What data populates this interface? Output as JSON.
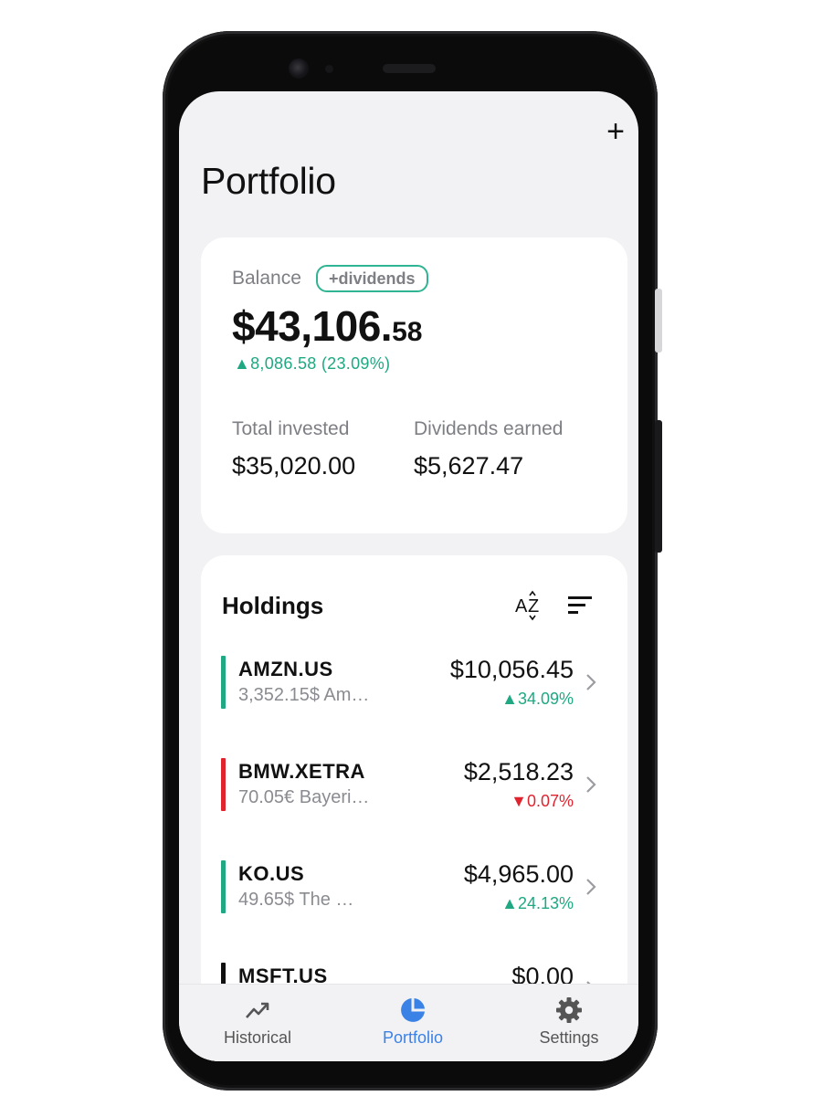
{
  "header": {
    "title": "Portfolio",
    "add_icon": "plus-icon",
    "add_label": "+"
  },
  "balance": {
    "label": "Balance",
    "badge": "+dividends",
    "amount_main": "$43,106.",
    "amount_cents": "58",
    "change": "▲8,086.58 (23.09%)",
    "total_invested_label": "Total invested",
    "total_invested_value": "$35,020.00",
    "dividends_label": "Dividends earned",
    "dividends_value": "$5,627.47"
  },
  "holdings": {
    "title": "Holdings",
    "sort_alpha_icon": "sort-alphabetical-icon",
    "sort_icon": "sort-lines-icon",
    "items": [
      {
        "ticker": "AMZN.US",
        "sub": "3,352.15$  Am…",
        "value": "$10,056.45",
        "change": "▲34.09%",
        "trend": "up"
      },
      {
        "ticker": "BMW.XETRA",
        "sub": "70.05€  Bayeri…",
        "value": "$2,518.23",
        "change": "▼0.07%",
        "trend": "down"
      },
      {
        "ticker": "KO.US",
        "sub": "49.65$  The …",
        "value": "$4,965.00",
        "change": "▲24.13%",
        "trend": "up"
      },
      {
        "ticker": "MSFT.US",
        "sub": "",
        "value": "$0.00",
        "change": "",
        "trend": "neutral"
      }
    ]
  },
  "colors": {
    "up": "#1fa882",
    "down": "#e0242f",
    "neutral": "#111111",
    "accent": "#3b82e6"
  },
  "nav": {
    "items": [
      {
        "label": "Historical",
        "icon": "trending-up-icon",
        "active": false
      },
      {
        "label": "Portfolio",
        "icon": "pie-chart-icon",
        "active": true
      },
      {
        "label": "Settings",
        "icon": "gear-icon",
        "active": false
      }
    ]
  }
}
